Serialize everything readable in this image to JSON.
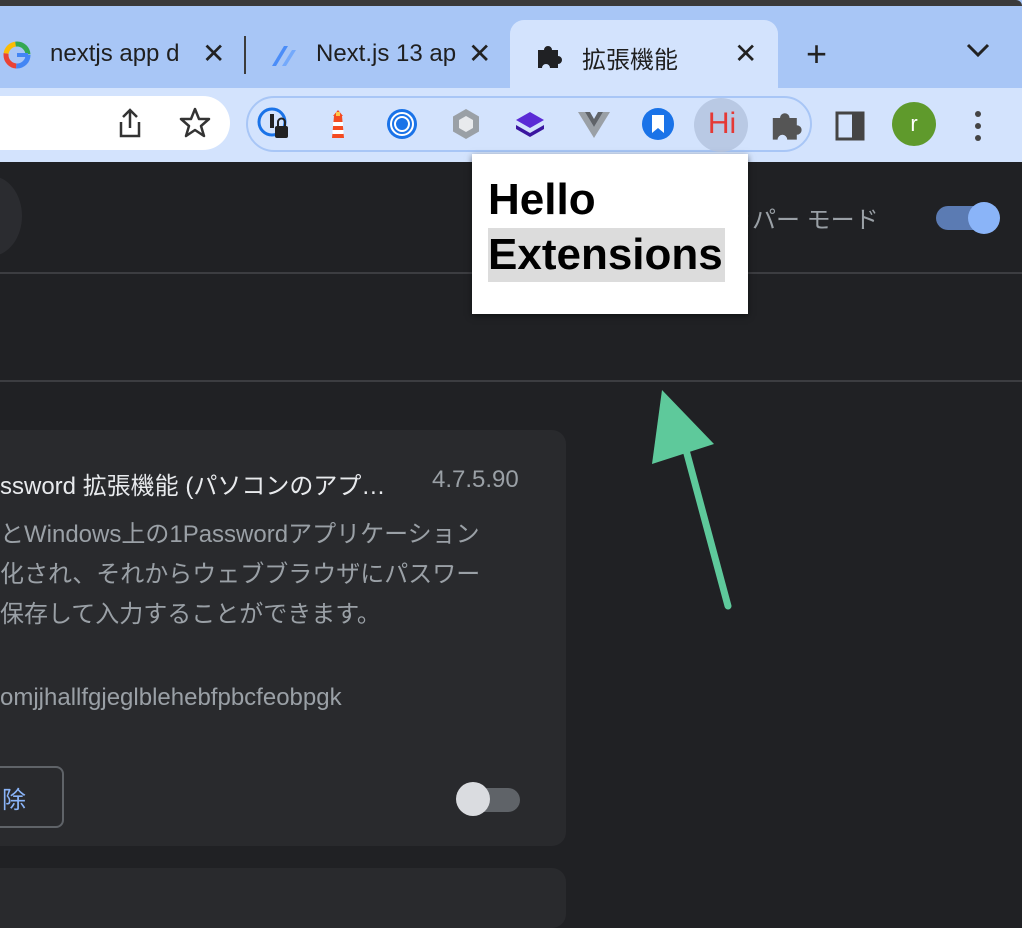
{
  "tabs": [
    {
      "title": "nextjs app d",
      "icon": "google-icon"
    },
    {
      "title": "Next.js 13 ap",
      "icon": "nextjs-blog-icon"
    },
    {
      "title": "拡張機能",
      "icon": "puzzle-icon",
      "active": true
    }
  ],
  "toolbar": {
    "extensions": [
      "1password-icon",
      "lighthouse-icon",
      "circle-target-icon",
      "hexagon-icon",
      "layers-icon",
      "vue-devtools-icon",
      "bookmark-icon",
      "hi-icon"
    ],
    "hi_label": "Hi",
    "avatar_letter": "r"
  },
  "header": {
    "developer_mode_label": "ッパー モード",
    "developer_mode_on": true
  },
  "popup": {
    "line1": "Hello",
    "line2": "Extensions"
  },
  "card": {
    "name": "ssword 拡張機能 (パソコンのアプ…",
    "version": "4.7.5.90",
    "description": [
      "とWindows上の1Passwordアプリケーション",
      "化され、それからウェブブラウザにパスワー",
      "保存して入力することができます。"
    ],
    "id": "omjjhallfgjeglblehebfpbcfeobpgk",
    "remove_label": "除",
    "enabled": false
  },
  "colors": {
    "accent": "#8ab4f8",
    "arrow": "#5ec99b"
  }
}
